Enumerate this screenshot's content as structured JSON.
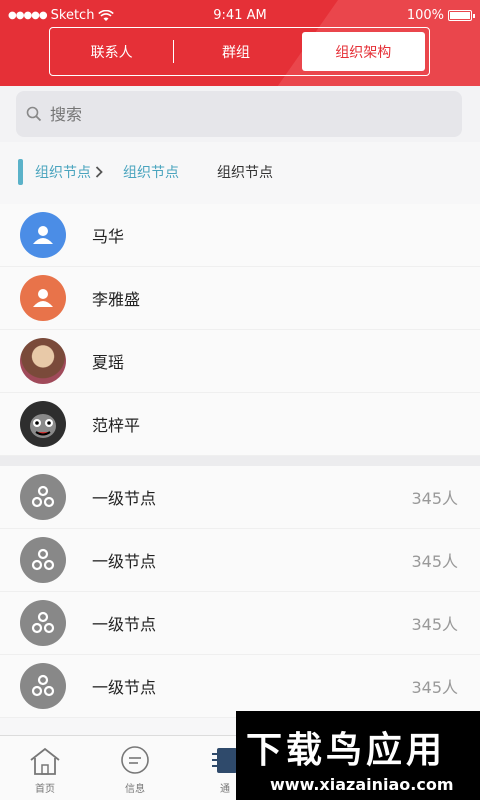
{
  "status_bar": {
    "carrier": "Sketch",
    "time": "9:41 AM",
    "battery": "100%"
  },
  "tabs": [
    {
      "label": "联系人"
    },
    {
      "label": "群组"
    },
    {
      "label": "组织架构"
    }
  ],
  "search": {
    "placeholder": "搜索"
  },
  "breadcrumb": [
    "组织节点",
    "组织节点",
    "组织节点"
  ],
  "contacts": [
    {
      "name": "马华",
      "avatar_color": "#4b8de6"
    },
    {
      "name": "李雅盛",
      "avatar_color": "#e8734a"
    },
    {
      "name": "夏瑶",
      "avatar_color": "#6b3b2e"
    },
    {
      "name": "范梓平",
      "avatar_color": "#3a3a3a"
    }
  ],
  "nodes": [
    {
      "name": "一级节点",
      "count": "345人"
    },
    {
      "name": "一级节点",
      "count": "345人"
    },
    {
      "name": "一级节点",
      "count": "345人"
    },
    {
      "name": "一级节点",
      "count": "345人"
    }
  ],
  "tabbar": [
    {
      "label": "首页",
      "icon": "home-icon"
    },
    {
      "label": "信息",
      "icon": "message-icon"
    },
    {
      "label": "通",
      "icon": "contacts-icon"
    }
  ],
  "watermark": {
    "title": "下载鸟应用",
    "url": "www.xiazainiao.com"
  }
}
